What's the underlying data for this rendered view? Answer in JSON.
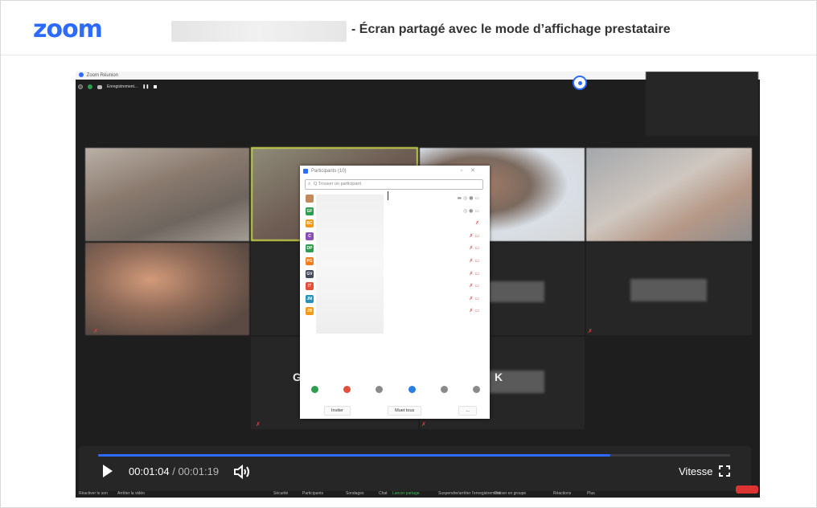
{
  "header": {
    "logo": "zoom",
    "title": "- Écran partagé avec le mode d’affichage prestataire"
  },
  "zoom_window": {
    "title": "Zoom Réunion",
    "recording_label": "Enregistrement..."
  },
  "participants_panel": {
    "title": "Participants (10)",
    "search_placeholder": "Q Trouver un participant",
    "participants": [
      {
        "initials": "",
        "color": "#c28a5c",
        "icons": "▬ ◎ ● ▭"
      },
      {
        "initials": "GF",
        "color": "#2e9d4e",
        "icons": "◎ ● ▭"
      },
      {
        "initials": "BC",
        "color": "#f29a17",
        "icons": "✗"
      },
      {
        "initials": "C",
        "color": "#8b4fb8",
        "icons": "✗ ▭"
      },
      {
        "initials": "DP",
        "color": "#2e9d4e",
        "icons": "✗ ▭"
      },
      {
        "initials": "PG",
        "color": "#f07d1e",
        "icons": "✗ ▭"
      },
      {
        "initials": "GV",
        "color": "#444a57",
        "icons": "✗ ▭"
      },
      {
        "initials": "IT",
        "color": "#e24f3c",
        "icons": "✗ ▭"
      },
      {
        "initials": "JM",
        "color": "#2a90b8",
        "icons": "✗ ▭"
      },
      {
        "initials": "JB",
        "color": "#f29a17",
        "icons": "✗ ▭"
      }
    ],
    "reactions": [
      {
        "name": "yes",
        "color": "#2e9d4e"
      },
      {
        "name": "no",
        "color": "#e24f3c"
      },
      {
        "name": "slower",
        "color": "#8a8a8a"
      },
      {
        "name": "faster",
        "color": "#2a7de1"
      },
      {
        "name": "more",
        "color": "#8a8a8a"
      },
      {
        "name": "clear",
        "color": "#8a8a8a"
      }
    ],
    "buttons": {
      "invite": "Inviter",
      "mute_all": "Muet tous",
      "more": "..."
    }
  },
  "tiles": {
    "letter_left": "G",
    "letter_right": "K"
  },
  "player": {
    "current_time": "00:01:04",
    "separator": "/",
    "total_time": "00:01:19",
    "progress_ratio": 0.81,
    "speed_label": "Vitesse"
  },
  "toolbar": [
    "Réactiver le son",
    "Arrêter la vidéo",
    "Sécurité",
    "Participants",
    "Sondages",
    "Chat",
    "Lancer partage",
    "Suspendre/arrêter l’enregistrement",
    "Diviser en groupe",
    "Réactions",
    "Plus"
  ]
}
